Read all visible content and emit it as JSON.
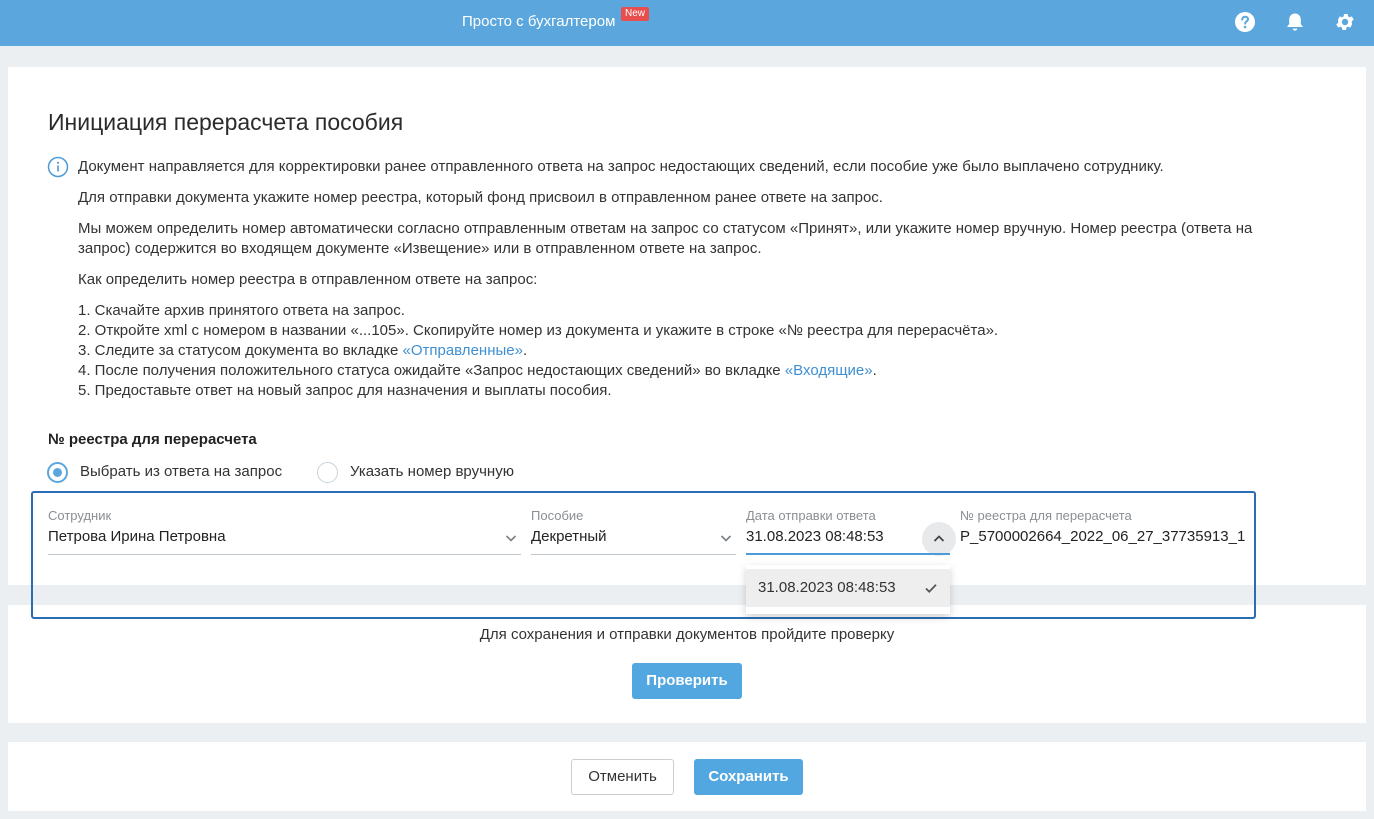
{
  "header": {
    "brand": "Просто с бухгалтером",
    "badge": "New",
    "icons": [
      "help-icon",
      "bell-icon",
      "gear-icon"
    ]
  },
  "page": {
    "title": "Инициация перерасчета пособия",
    "info": {
      "p1": "Документ направляется для корректировки ранее отправленного ответа на запрос недостающих сведений, если пособие уже было выплачено сотруднику.",
      "p2": "Для отправки документа укажите номер реестра, который фонд присвоил в отправленном ранее ответе на запрос.",
      "p3_line1": "Мы можем определить номер автоматически согласно отправленным ответам на запрос со статусом «Принят», или укажите номер вручную. Номер реестра (ответа на",
      "p3_line2": "запрос) содержится во входящем документе «Извещение» или в отправленном ответе на запрос.",
      "p4": "Как определить номер реестра в отправленном ответе на запрос:",
      "step1": "1. Скачайте архив принятого ответа на запрос.",
      "step2": "2. Откройте xml с номером в названии «...105». Скопируйте номер из документа и укажите в строке «№ реестра для перерасчёта».",
      "step3_prefix": "3. Следите за статусом документа во вкладке ",
      "step3_link": "«Отправленные»",
      "step3_suffix": ".",
      "step4_prefix": "4. После получения положительного статуса ожидайте «Запрос недостающих сведений» во вкладке ",
      "step4_link": "«Входящие»",
      "step4_suffix": ".",
      "step5": "5. Предоставьте ответ на новый запрос для назначения и выплаты пособия."
    },
    "registry_section_label": "№ реестра для перерасчета",
    "radio": {
      "option1": "Выбрать из ответа на запрос",
      "option2": "Указать номер вручную",
      "selected": "option1"
    },
    "fields": {
      "employee": {
        "label": "Сотрудник",
        "value": "Петрова Ирина Петровна"
      },
      "benefit": {
        "label": "Пособие",
        "value": "Декретный"
      },
      "send_date": {
        "label": "Дата отправки ответа",
        "value": "31.08.2023 08:48:53"
      },
      "registry": {
        "label": "№ реестра для перерасчета",
        "value": "P_5700002664_2022_06_27_37735913_1"
      }
    },
    "dropdown": {
      "options": [
        "31.08.2023 08:48:53"
      ],
      "selected": "31.08.2023 08:48:53"
    },
    "verify": {
      "message": "Для сохранения и отправки документов пройдите проверку",
      "button": "Проверить"
    }
  },
  "footer": {
    "cancel": "Отменить",
    "save": "Сохранить"
  },
  "colors": {
    "topbar": "#5ba7dd",
    "accent": "#53a7e0",
    "link": "#3f8fd2",
    "badge": "#e94e4e",
    "frame": "#2a6db5"
  }
}
